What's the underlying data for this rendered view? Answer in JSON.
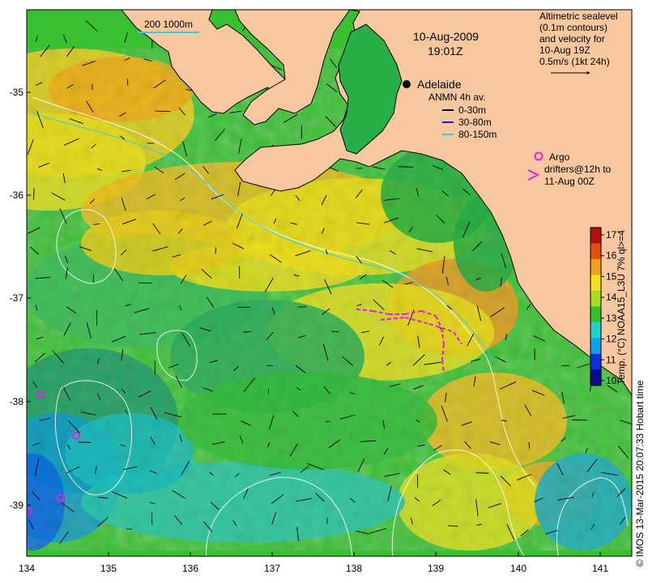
{
  "header": {
    "date": "10-Aug-2009",
    "time": "19:01Z"
  },
  "scale_bar": {
    "label": "200  1000m"
  },
  "altimetric_note": {
    "lines": [
      "Altimetric sealevel",
      "(0.1m contours)",
      "and velocity for",
      "10-Aug 19Z",
      "0.5m/s (1kt 24h)"
    ]
  },
  "places": {
    "adelaide": "Adelaide"
  },
  "anmn_legend": {
    "title": "ANMN 4h av.",
    "items": [
      {
        "label": "0-30m",
        "color": "#000000"
      },
      {
        "label": "30-80m",
        "color": "#1a1adc"
      },
      {
        "label": "80-150m",
        "color": "#33ccee"
      }
    ]
  },
  "argo_legend": {
    "argo": "Argo",
    "drifters": [
      "drifters@12h to",
      "11-Aug 00Z"
    ]
  },
  "colorbar": {
    "title": "Temp. (°C) NOAA15_L3U 7% ql>=4",
    "ticks": [
      "10",
      "11",
      "12",
      "13",
      "14",
      "15",
      "16",
      "17"
    ],
    "colors": [
      "#0a0a8a",
      "#1030e0",
      "#10a0ee",
      "#20d0c8",
      "#30c030",
      "#a0e020",
      "#f0e020",
      "#f0a020",
      "#e05010",
      "#b01010"
    ]
  },
  "credit": "© IMOS 13-Mar-2015 20:07:33 Hobart time",
  "axes": {
    "x_ticks": [
      "134",
      "135",
      "136",
      "137",
      "138",
      "139",
      "140",
      "141"
    ],
    "y_ticks": [
      "-35",
      "-36",
      "-37",
      "-38",
      "-39"
    ]
  },
  "colors": {
    "land": "#f7c8a0",
    "coast": "#000000",
    "contour": "#ffffff",
    "drifter": "#e020e0"
  }
}
